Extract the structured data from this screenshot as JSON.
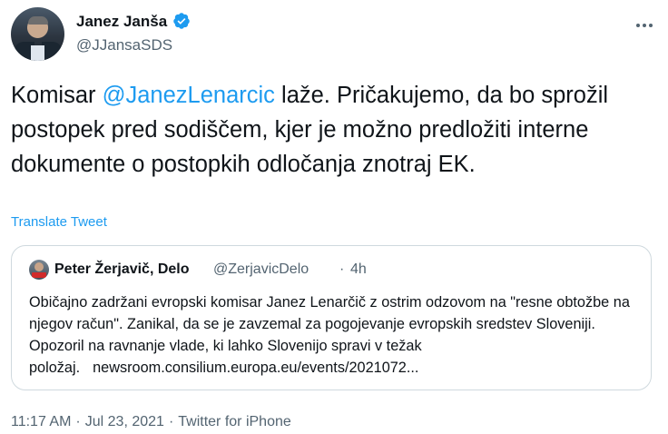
{
  "tweet": {
    "author_name": "Janez Janša",
    "author_handle": "@JJansaSDS",
    "text_before_mention": "Komisar ",
    "mention": "@JanezLenarcic",
    "text_after_mention": " laže. Pričakujemo, da bo sprožil postopek pred sodiščem, kjer je možno predložiti interne dokumente o postopkih odločanja znotraj EK.",
    "translate_label": "Translate Tweet",
    "timestamp_time": "11:17 AM",
    "separator": "·",
    "timestamp_date": "Jul 23, 2021",
    "source": "Twitter for iPhone",
    "icons": {
      "verified": "verified-badge-icon",
      "more": "more-options-icon"
    },
    "colors": {
      "accent": "#1d9bf0",
      "muted": "#536471",
      "border": "#cfd9de"
    }
  },
  "quote": {
    "author_name": "Peter Žerjavič, Delo",
    "author_handle": "@ZerjavicDelo",
    "dot": "·",
    "time": "4h",
    "text": "Običajno zadržani evropski komisar Janez Lenarčič z ostrim odzovom na \"resne obtožbe na njegov račun\". Zanikal, da se je zavzemal za pogojevanje evropskih sredstev Sloveniji. Opozoril na ravnanje vlade, ki lahko Slovenijo spravi v težak položaj.",
    "link": "newsroom.consilium.europa.eu/events/2021072..."
  }
}
